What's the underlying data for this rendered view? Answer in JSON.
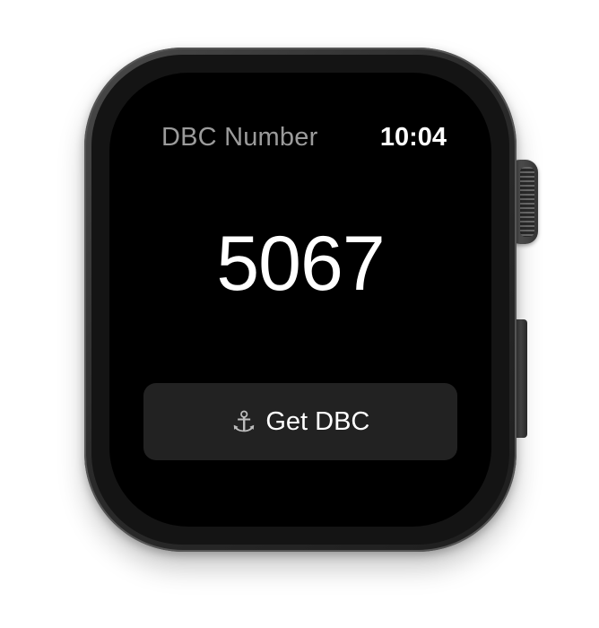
{
  "app": {
    "title": "DBC Number",
    "time": "10:04"
  },
  "main": {
    "number": "5067"
  },
  "action": {
    "label": "Get DBC",
    "icon": "anchor-icon",
    "icon_glyph": "⚓"
  },
  "colors": {
    "screen_background": "#000000",
    "button_background": "#222222",
    "title_color": "#9b9b9b",
    "text_color": "#ffffff"
  }
}
